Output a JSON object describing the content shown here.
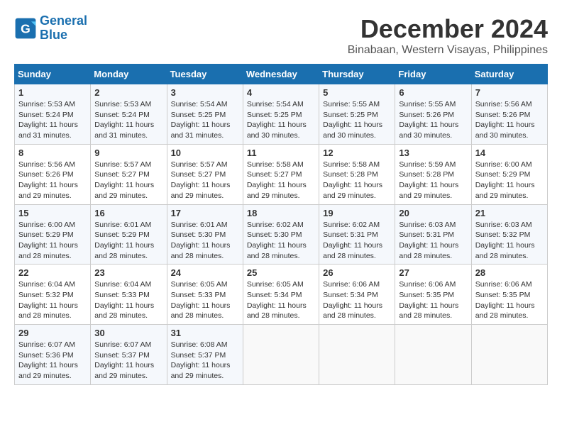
{
  "header": {
    "logo_line1": "General",
    "logo_line2": "Blue",
    "title": "December 2024",
    "subtitle": "Binabaan, Western Visayas, Philippines"
  },
  "calendar": {
    "columns": [
      "Sunday",
      "Monday",
      "Tuesday",
      "Wednesday",
      "Thursday",
      "Friday",
      "Saturday"
    ],
    "weeks": [
      [
        null,
        null,
        null,
        null,
        null,
        null,
        null
      ]
    ],
    "days": {
      "1": {
        "sunrise": "5:53 AM",
        "sunset": "5:24 PM",
        "daylight": "11 hours and 31 minutes."
      },
      "2": {
        "sunrise": "5:53 AM",
        "sunset": "5:24 PM",
        "daylight": "11 hours and 31 minutes."
      },
      "3": {
        "sunrise": "5:54 AM",
        "sunset": "5:25 PM",
        "daylight": "11 hours and 31 minutes."
      },
      "4": {
        "sunrise": "5:54 AM",
        "sunset": "5:25 PM",
        "daylight": "11 hours and 30 minutes."
      },
      "5": {
        "sunrise": "5:55 AM",
        "sunset": "5:25 PM",
        "daylight": "11 hours and 30 minutes."
      },
      "6": {
        "sunrise": "5:55 AM",
        "sunset": "5:26 PM",
        "daylight": "11 hours and 30 minutes."
      },
      "7": {
        "sunrise": "5:56 AM",
        "sunset": "5:26 PM",
        "daylight": "11 hours and 30 minutes."
      },
      "8": {
        "sunrise": "5:56 AM",
        "sunset": "5:26 PM",
        "daylight": "11 hours and 29 minutes."
      },
      "9": {
        "sunrise": "5:57 AM",
        "sunset": "5:27 PM",
        "daylight": "11 hours and 29 minutes."
      },
      "10": {
        "sunrise": "5:57 AM",
        "sunset": "5:27 PM",
        "daylight": "11 hours and 29 minutes."
      },
      "11": {
        "sunrise": "5:58 AM",
        "sunset": "5:27 PM",
        "daylight": "11 hours and 29 minutes."
      },
      "12": {
        "sunrise": "5:58 AM",
        "sunset": "5:28 PM",
        "daylight": "11 hours and 29 minutes."
      },
      "13": {
        "sunrise": "5:59 AM",
        "sunset": "5:28 PM",
        "daylight": "11 hours and 29 minutes."
      },
      "14": {
        "sunrise": "6:00 AM",
        "sunset": "5:29 PM",
        "daylight": "11 hours and 29 minutes."
      },
      "15": {
        "sunrise": "6:00 AM",
        "sunset": "5:29 PM",
        "daylight": "11 hours and 28 minutes."
      },
      "16": {
        "sunrise": "6:01 AM",
        "sunset": "5:29 PM",
        "daylight": "11 hours and 28 minutes."
      },
      "17": {
        "sunrise": "6:01 AM",
        "sunset": "5:30 PM",
        "daylight": "11 hours and 28 minutes."
      },
      "18": {
        "sunrise": "6:02 AM",
        "sunset": "5:30 PM",
        "daylight": "11 hours and 28 minutes."
      },
      "19": {
        "sunrise": "6:02 AM",
        "sunset": "5:31 PM",
        "daylight": "11 hours and 28 minutes."
      },
      "20": {
        "sunrise": "6:03 AM",
        "sunset": "5:31 PM",
        "daylight": "11 hours and 28 minutes."
      },
      "21": {
        "sunrise": "6:03 AM",
        "sunset": "5:32 PM",
        "daylight": "11 hours and 28 minutes."
      },
      "22": {
        "sunrise": "6:04 AM",
        "sunset": "5:32 PM",
        "daylight": "11 hours and 28 minutes."
      },
      "23": {
        "sunrise": "6:04 AM",
        "sunset": "5:33 PM",
        "daylight": "11 hours and 28 minutes."
      },
      "24": {
        "sunrise": "6:05 AM",
        "sunset": "5:33 PM",
        "daylight": "11 hours and 28 minutes."
      },
      "25": {
        "sunrise": "6:05 AM",
        "sunset": "5:34 PM",
        "daylight": "11 hours and 28 minutes."
      },
      "26": {
        "sunrise": "6:06 AM",
        "sunset": "5:34 PM",
        "daylight": "11 hours and 28 minutes."
      },
      "27": {
        "sunrise": "6:06 AM",
        "sunset": "5:35 PM",
        "daylight": "11 hours and 28 minutes."
      },
      "28": {
        "sunrise": "6:06 AM",
        "sunset": "5:35 PM",
        "daylight": "11 hours and 28 minutes."
      },
      "29": {
        "sunrise": "6:07 AM",
        "sunset": "5:36 PM",
        "daylight": "11 hours and 29 minutes."
      },
      "30": {
        "sunrise": "6:07 AM",
        "sunset": "5:37 PM",
        "daylight": "11 hours and 29 minutes."
      },
      "31": {
        "sunrise": "6:08 AM",
        "sunset": "5:37 PM",
        "daylight": "11 hours and 29 minutes."
      }
    }
  }
}
